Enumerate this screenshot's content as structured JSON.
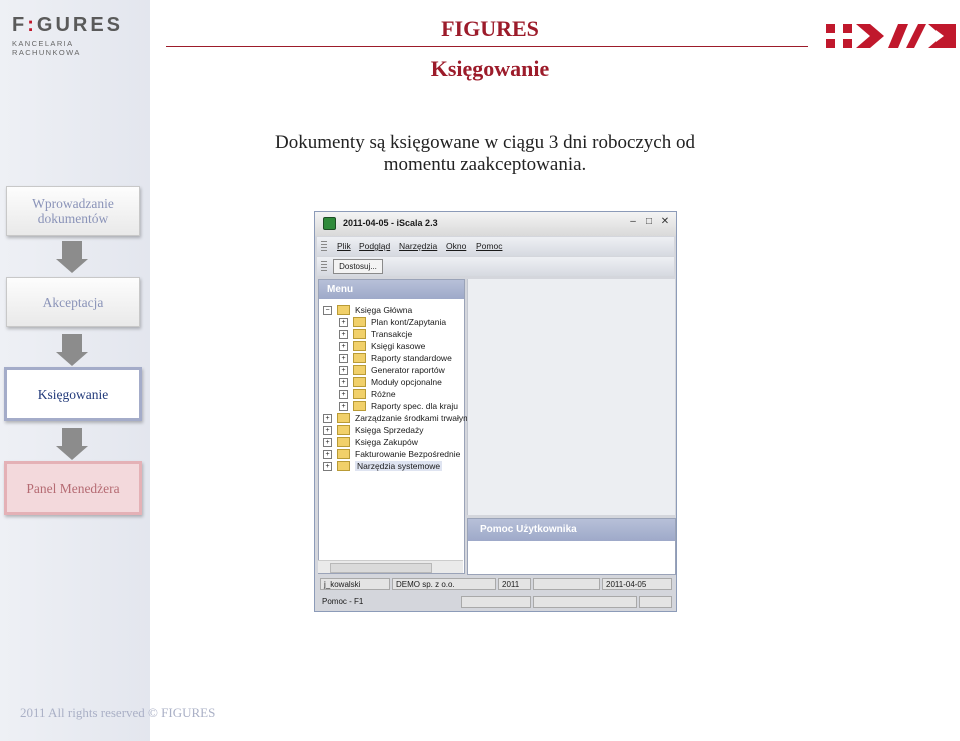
{
  "logo": {
    "main": "FIGURES",
    "sub": "KANCELARIA RACHUNKOWA"
  },
  "header": {
    "title": "FIGURES",
    "subtitle": "Księgowanie"
  },
  "description": "Dokumenty są księgowane w ciągu 3 dni roboczych od momentu zaakceptowania.",
  "steps": [
    {
      "label": "Wprowadzanie dokumentów"
    },
    {
      "label": "Akceptacja"
    },
    {
      "label": "Księgowanie"
    },
    {
      "label": "Panel Menedżera"
    }
  ],
  "footer": "2011 All rights reserved © FIGURES",
  "app": {
    "title": "2011-04-05 - iScala 2.3",
    "menu": [
      "Plik",
      "Podgląd",
      "Narzędzia",
      "Okno",
      "Pomoc"
    ],
    "toolbar_button": "Dostosuj...",
    "menu_panel_title": "Menu",
    "tree": [
      {
        "label": "Księga Główna",
        "level": 0,
        "sign": "−"
      },
      {
        "label": "Plan kont/Zapytania",
        "level": 1,
        "sign": "+"
      },
      {
        "label": "Transakcje",
        "level": 1,
        "sign": "+"
      },
      {
        "label": "Księgi kasowe",
        "level": 1,
        "sign": "+"
      },
      {
        "label": "Raporty standardowe",
        "level": 1,
        "sign": "+"
      },
      {
        "label": "Generator raportów",
        "level": 1,
        "sign": "+"
      },
      {
        "label": "Moduły opcjonalne",
        "level": 1,
        "sign": "+"
      },
      {
        "label": "Różne",
        "level": 1,
        "sign": "+"
      },
      {
        "label": "Raporty spec. dla kraju",
        "level": 1,
        "sign": "+"
      },
      {
        "label": "Zarządzanie środkami trwałym",
        "level": 0,
        "sign": "+"
      },
      {
        "label": "Księga Sprzedaży",
        "level": 0,
        "sign": "+"
      },
      {
        "label": "Księga Zakupów",
        "level": 0,
        "sign": "+"
      },
      {
        "label": "Fakturowanie Bezpośrednie",
        "level": 0,
        "sign": "+"
      },
      {
        "label": "Narzędzia systemowe",
        "level": 0,
        "sign": "+",
        "selected": true
      }
    ],
    "help_panel_title": "Pomoc Użytkownika",
    "status": {
      "user": "j_kowalski",
      "company": "DEMO sp. z o.o.",
      "year": "2011",
      "date": "2011-04-05",
      "hint": "Pomoc - F1"
    }
  }
}
